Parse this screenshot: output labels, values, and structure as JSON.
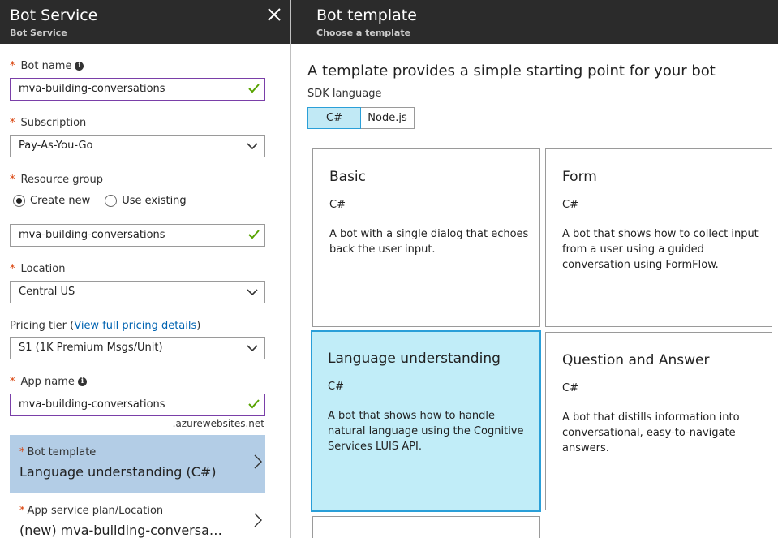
{
  "left_blade": {
    "title": "Bot Service",
    "subtitle": "Bot Service",
    "fields": {
      "bot_name": {
        "required": "*",
        "label": "Bot name",
        "value": "mva-building-conversations"
      },
      "subscription": {
        "required": "*",
        "label": "Subscription",
        "value": "Pay-As-You-Go"
      },
      "resource_group": {
        "required": "*",
        "label": "Resource group",
        "option_create": "Create new",
        "option_existing": "Use existing",
        "selected_option": "Create new",
        "value": "mva-building-conversations"
      },
      "location": {
        "required": "*",
        "label": "Location",
        "value": "Central US"
      },
      "pricing_tier": {
        "label_prefix": "Pricing tier (",
        "link": "View full pricing details",
        "label_suffix": ")",
        "value": "S1 (1K Premium Msgs/Unit)"
      },
      "app_name": {
        "required": "*",
        "label": "App name",
        "value": "mva-building-conversations",
        "suffix": ".azurewebsites.net"
      },
      "bot_template": {
        "required": "*",
        "label": "Bot template",
        "value": "Language understanding (C#)"
      },
      "app_service_plan": {
        "required": "*",
        "label": "App service plan/Location",
        "value": "(new) mva-building-conversatio..."
      }
    }
  },
  "right_blade": {
    "title": "Bot template",
    "subtitle": "Choose a template",
    "intro": "A template provides a simple starting point for your bot",
    "sdk_label": "SDK language",
    "sdk_options": [
      "C#",
      "Node.js"
    ],
    "sdk_selected": "C#",
    "templates": [
      {
        "title": "Basic",
        "lang": "C#",
        "desc": "A bot with a single dialog that echoes back the user input."
      },
      {
        "title": "Form",
        "lang": "C#",
        "desc": "A bot that shows how to collect input from a user using a guided conversation using FormFlow."
      },
      {
        "title": "Language understanding",
        "lang": "C#",
        "desc": "A bot that shows how to handle natural language using the Cognitive Services LUIS API."
      },
      {
        "title": "Question and Answer",
        "lang": "C#",
        "desc": "A bot that distills information into conversational, easy-to-navigate answers."
      }
    ],
    "selected_template": "Language understanding"
  },
  "colors": {
    "header_bg": "#2b2b2b",
    "accent_blue": "#2a9fd8",
    "selected_card_bg": "#c1edf8",
    "selected_nav_bg": "#b3cde6",
    "required_star": "#d83b01",
    "check_green": "#57a300",
    "link": "#0063b1"
  },
  "icons": [
    "close-icon",
    "info-icon",
    "check-icon",
    "chevron-down-icon",
    "chevron-right-icon",
    "radio-icon"
  ]
}
